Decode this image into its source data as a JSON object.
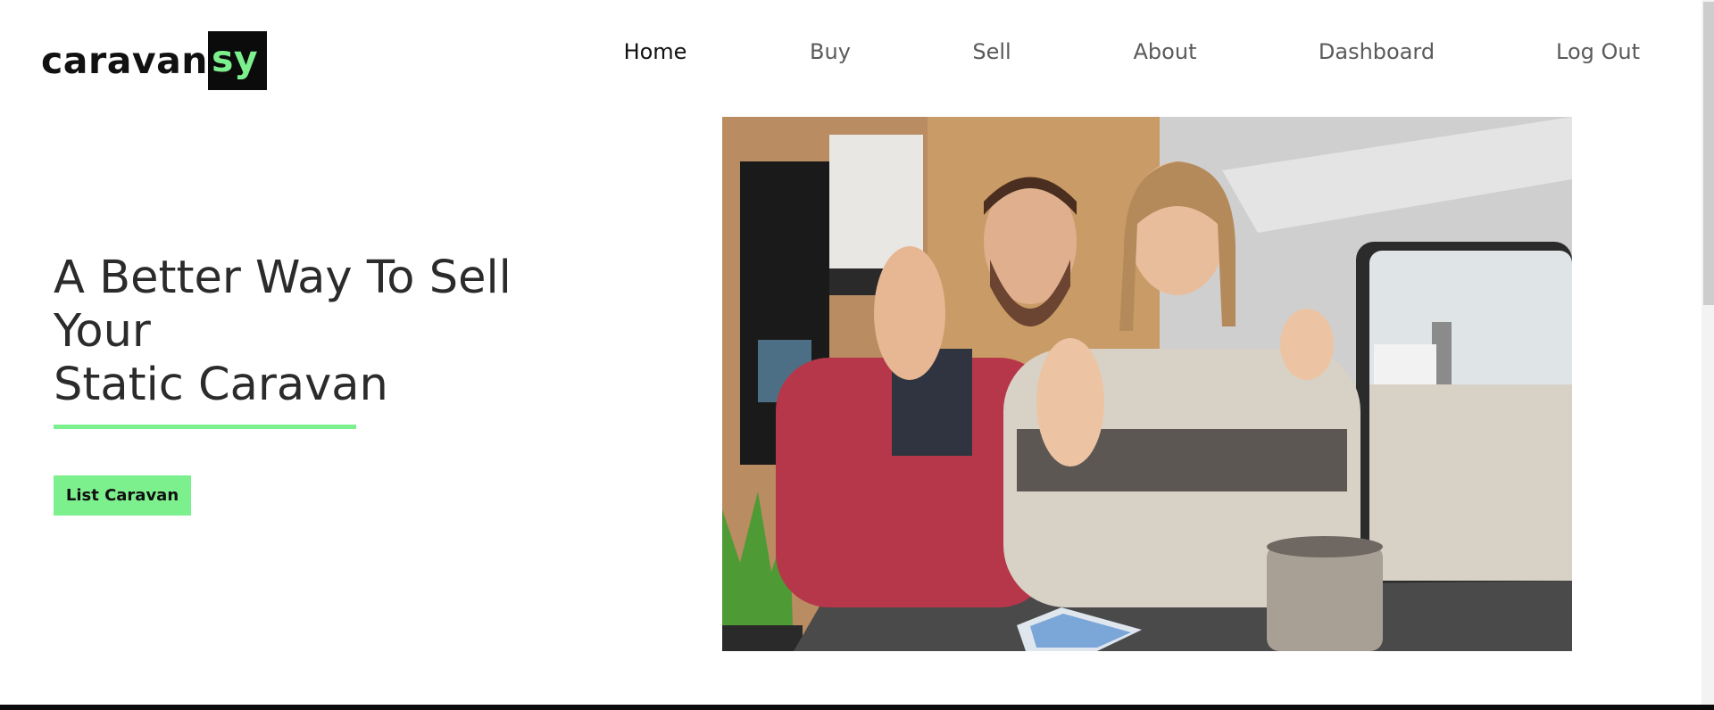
{
  "logo": {
    "text_main": "caravan",
    "text_accent": "sy"
  },
  "nav": {
    "home": "Home",
    "buy": "Buy",
    "sell": "Sell",
    "about": "About",
    "dashboard": "Dashboard",
    "logout": "Log Out"
  },
  "hero": {
    "title_line1": "A Better Way To Sell",
    "title_line2": "Your",
    "title_line3": "Static Caravan",
    "cta_label": "List Caravan",
    "image_alt": "Smiling couple waving inside a caravan"
  },
  "colors": {
    "accent": "#7df08e",
    "dark": "#0b0b0b",
    "text": "#2b2b2b",
    "nav_inactive": "#5a5a5a"
  }
}
